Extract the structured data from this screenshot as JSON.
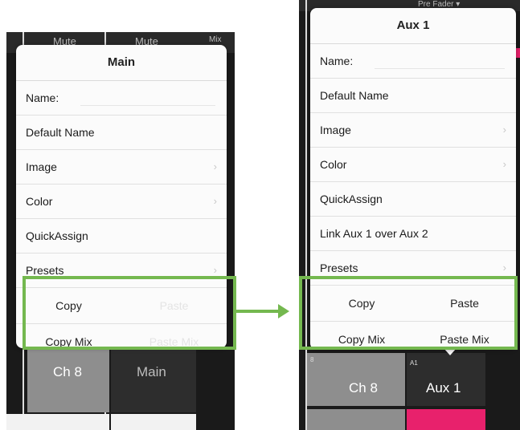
{
  "left": {
    "bg_labels": {
      "mute_a": "Mute",
      "mute_b": "Mute",
      "mix": "Mix"
    },
    "popover": {
      "title": "Main",
      "rows": [
        {
          "label": "Name:"
        },
        {
          "label": "Default Name"
        },
        {
          "label": "Image",
          "chevron": "›"
        },
        {
          "label": "Color",
          "chevron": "›"
        },
        {
          "label": "QuickAssign"
        },
        {
          "label": "Presets",
          "chevron": "›"
        }
      ],
      "buttons": [
        [
          {
            "label": "Copy"
          },
          {
            "label": "Paste",
            "disabled": true
          }
        ],
        [
          {
            "label": "Copy Mix"
          },
          {
            "label": "Paste Mix",
            "disabled": true
          }
        ]
      ]
    },
    "channels": {
      "ch8_small": "8",
      "ch8": "Ch 8",
      "main_small": "LR",
      "main": "Main"
    }
  },
  "right": {
    "bg_labels": {
      "pre_fader": "Pre Fader ▾"
    },
    "popover": {
      "title": "Aux 1",
      "rows": [
        {
          "label": "Name:"
        },
        {
          "label": "Default Name"
        },
        {
          "label": "Image",
          "chevron": "›"
        },
        {
          "label": "Color",
          "chevron": "›"
        },
        {
          "label": "QuickAssign"
        },
        {
          "label": "Link Aux 1 over Aux 2"
        },
        {
          "label": "Presets",
          "chevron": "›"
        }
      ],
      "buttons": [
        [
          {
            "label": "Copy"
          },
          {
            "label": "Paste"
          }
        ],
        [
          {
            "label": "Copy Mix"
          },
          {
            "label": "Paste Mix"
          }
        ]
      ]
    },
    "channels": {
      "ch8_small": "8",
      "ch8": "Ch 8",
      "aux_small": "A1",
      "aux": "Aux 1"
    }
  },
  "colors": {
    "highlight": "#74b84f",
    "accent_pink": "#e8216c"
  }
}
